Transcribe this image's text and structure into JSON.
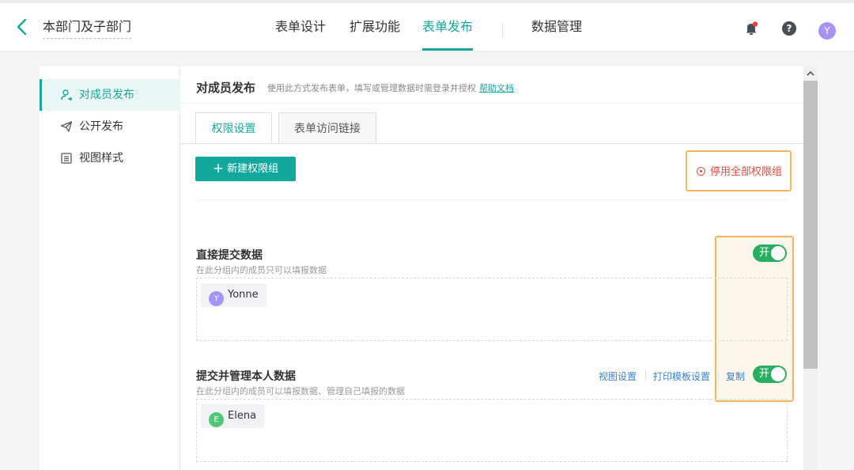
{
  "header": {
    "title": "本部门及子部门",
    "nav": [
      "表单设计",
      "扩展功能",
      "表单发布",
      "数据管理"
    ],
    "active_nav": "表单发布",
    "avatar_letter": "Y"
  },
  "sidebar": {
    "items": [
      {
        "label": "对成员发布",
        "icon": "user-share-icon",
        "active": true
      },
      {
        "label": "公开发布",
        "icon": "send-icon",
        "active": false
      },
      {
        "label": "视图样式",
        "icon": "list-icon",
        "active": false
      }
    ]
  },
  "main": {
    "title": "对成员发布",
    "desc": "使用此方式发布表单，填写或管理数据时需登录并授权",
    "help_link": "帮助文档",
    "tabs": [
      "权限设置",
      "表单访问链接"
    ],
    "active_tab": "权限设置",
    "new_group_button": "新建权限组",
    "stop_all_link": "停用全部权限组",
    "groups": [
      {
        "title": "直接提交数据",
        "desc": "在此分组内的成员只可以填报数据",
        "toggle_label": "开",
        "toggle_on": true,
        "members": [
          {
            "initial": "Y",
            "name": "Yonne",
            "color": "#a693f5"
          }
        ],
        "actions": []
      },
      {
        "title": "提交并管理本人数据",
        "desc": "在此分组内的成员可以填报数据、管理自己填报的数据",
        "toggle_label": "开",
        "toggle_on": true,
        "members": [
          {
            "initial": "E",
            "name": "Elena",
            "color": "#52c77a"
          }
        ],
        "actions": [
          "视图设置",
          "打印模板设置",
          "复制"
        ]
      }
    ]
  },
  "colors": {
    "accent": "#13a89e",
    "toggle_on": "#27ae60",
    "highlight": "#f5b55e",
    "danger": "#e8493c",
    "link": "#3a7fd5"
  }
}
